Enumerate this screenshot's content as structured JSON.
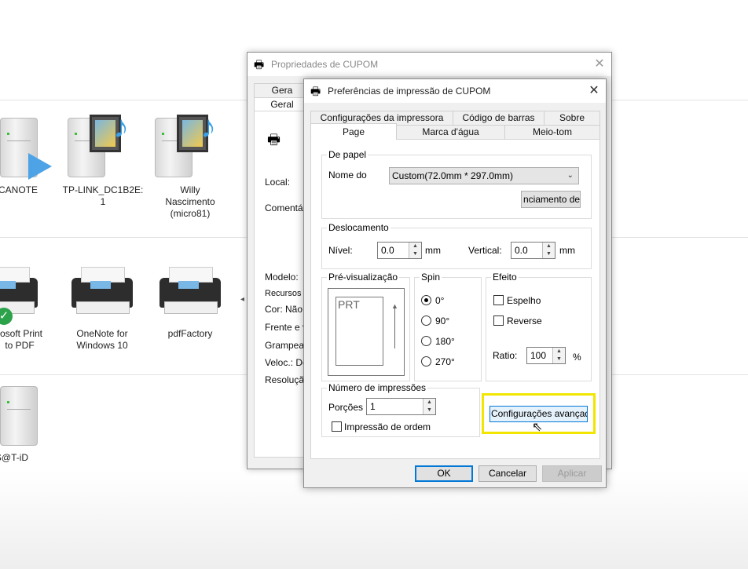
{
  "desktop": {
    "devices": [
      {
        "label": "CANOTE"
      },
      {
        "label": "TP-LINK_DC1B2E:\n1"
      },
      {
        "label": "Willy\nNascimento\n(micro81)"
      },
      {
        "label": "rosoft Print\nto PDF"
      },
      {
        "label": "OneNote for\nWindows 10"
      },
      {
        "label": "pdfFactory"
      },
      {
        "label": "S@T-iD"
      }
    ]
  },
  "back_window": {
    "title": "Propriedades de CUPOM",
    "tabs": [
      "Gera",
      "Geral"
    ],
    "labels": {
      "local": "Local:",
      "comentario": "Comentá",
      "modelo": "Modelo:",
      "recursos": "Recursos",
      "cor": "Cor: Não",
      "frente": "Frente e v",
      "grampear": "Grampea",
      "veloc": "Veloc.: De",
      "resolucao": "Resoluçã"
    }
  },
  "dialog": {
    "title": "Preferências de impressão de CUPOM",
    "tabs_row1": [
      "Configurações da impressora",
      "Código de barras",
      "Sobre"
    ],
    "tabs_row2": [
      "Page",
      "Marca d'água",
      "Meio-tom"
    ],
    "paper": {
      "group": "De papel",
      "name_label": "Nome do",
      "name_value": "Custom(72.0mm * 297.0mm)",
      "manage_button": "nciamento de p"
    },
    "offset": {
      "group": "Deslocamento",
      "nivel_label": "Nível:",
      "nivel_value": "0.0",
      "nivel_unit": "mm",
      "vertical_label": "Vertical:",
      "vertical_value": "0.0",
      "vertical_unit": "mm"
    },
    "preview": {
      "group": "Pré-visualização",
      "text": "PRT"
    },
    "spin": {
      "group": "Spin",
      "options": [
        "0°",
        "90°",
        "180°",
        "270°"
      ],
      "selected": "0°"
    },
    "effect": {
      "group": "Efeito",
      "espelho": "Espelho",
      "reverse": "Reverse",
      "ratio_label": "Ratio:",
      "ratio_value": "100",
      "ratio_unit": "%"
    },
    "copies": {
      "group": "Número de impressões",
      "portions_label": "Porções",
      "portions_value": "1",
      "order_label": "Impressão de ordem"
    },
    "advanced_button": "Configurações avançadas",
    "buttons": {
      "ok": "OK",
      "cancel": "Cancelar",
      "apply": "Aplicar"
    }
  },
  "colors": {
    "highlight": "#f2e600",
    "ok_border": "#0078d7"
  }
}
